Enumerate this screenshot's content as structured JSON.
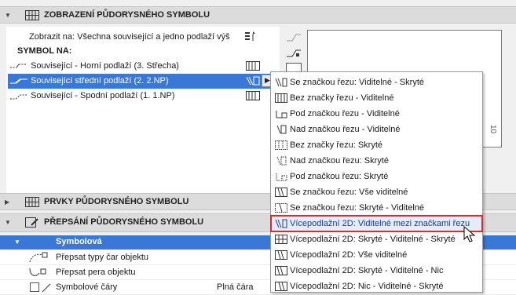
{
  "sections": {
    "display": {
      "title": "ZOBRAZENÍ PŮDORYSNÉHO SYMBOLU",
      "icon": "floor-plan-display-icon"
    },
    "elements": {
      "title": "PRVKY PŮDORYSNÉHO SYMBOLU",
      "icon": "floor-plan-elements-icon"
    },
    "override": {
      "title": "PŘEPSÁNÍ PŮDORYSNÉHO SYMBOLU",
      "icon": "floor-plan-override-icon"
    }
  },
  "display": {
    "show_on": "Zobrazit na: Všechna související a jedno podlaží výš",
    "symbol_label": "SYMBOL NA:",
    "rows": [
      {
        "label": "Související - Horní podlaží (3. Střecha)"
      },
      {
        "label": "Související střední podlaží (2. 2.NP)"
      },
      {
        "label": "Související - Spodní podlaží (1. 1.NP)"
      }
    ]
  },
  "menu": {
    "items": [
      {
        "label": "Se značkou řezu: Viditelné - Skryté",
        "icon": "cut-visible-hidden-icon"
      },
      {
        "label": "Bez značky řezu - Viditelné",
        "icon": "no-cut-visible-icon"
      },
      {
        "label": "Pod značkou řezu - Viditelné",
        "icon": "below-cut-visible-icon"
      },
      {
        "label": "Nad značkou řezu - Viditelné",
        "icon": "above-cut-visible-icon"
      },
      {
        "label": "Bez značky řezu: Skryté",
        "icon": "no-cut-hidden-icon"
      },
      {
        "label": "Nad značkou řezu: Skryté",
        "icon": "above-cut-hidden-icon"
      },
      {
        "label": "Pod značkou řezu: Skryté",
        "icon": "below-cut-hidden-icon"
      },
      {
        "label": "Se značkou řezu: Vše viditelné",
        "icon": "cut-all-visible-icon"
      },
      {
        "label": "Se značkou řezu: Skryté - Viditelné",
        "icon": "cut-hidden-visible-icon"
      },
      {
        "label": "Vícepodlažní 2D: Viditelné mezi značkami řezu",
        "icon": "multistory-between-cuts-icon"
      },
      {
        "label": "Vícepodlažní 2D: Skryté - Viditelné - Skryté",
        "icon": "multistory-hvh-icon"
      },
      {
        "label": "Vícepodlažní 2D: Vše viditelné",
        "icon": "multistory-all-visible-icon"
      },
      {
        "label": "Vícepodlažní 2D: Skryté - Viditelné - Nic",
        "icon": "multistory-hvn-icon"
      },
      {
        "label": "Vícepodlažní 2D: Nic - Viditelné - Skryté",
        "icon": "multistory-nvh-icon"
      }
    ],
    "highlighted_index": 9
  },
  "override": {
    "group": "Symbolová",
    "rows": [
      {
        "label": "Přepsat typy čar objektu",
        "value": ""
      },
      {
        "label": "Přepsat pera objektu",
        "value": ""
      },
      {
        "label": "Symbolové čáry",
        "value": "Plná čára"
      }
    ]
  },
  "preview": {
    "value": "10"
  },
  "colors": {
    "selection": "#3a78d8",
    "highlight_border": "#e02828"
  }
}
